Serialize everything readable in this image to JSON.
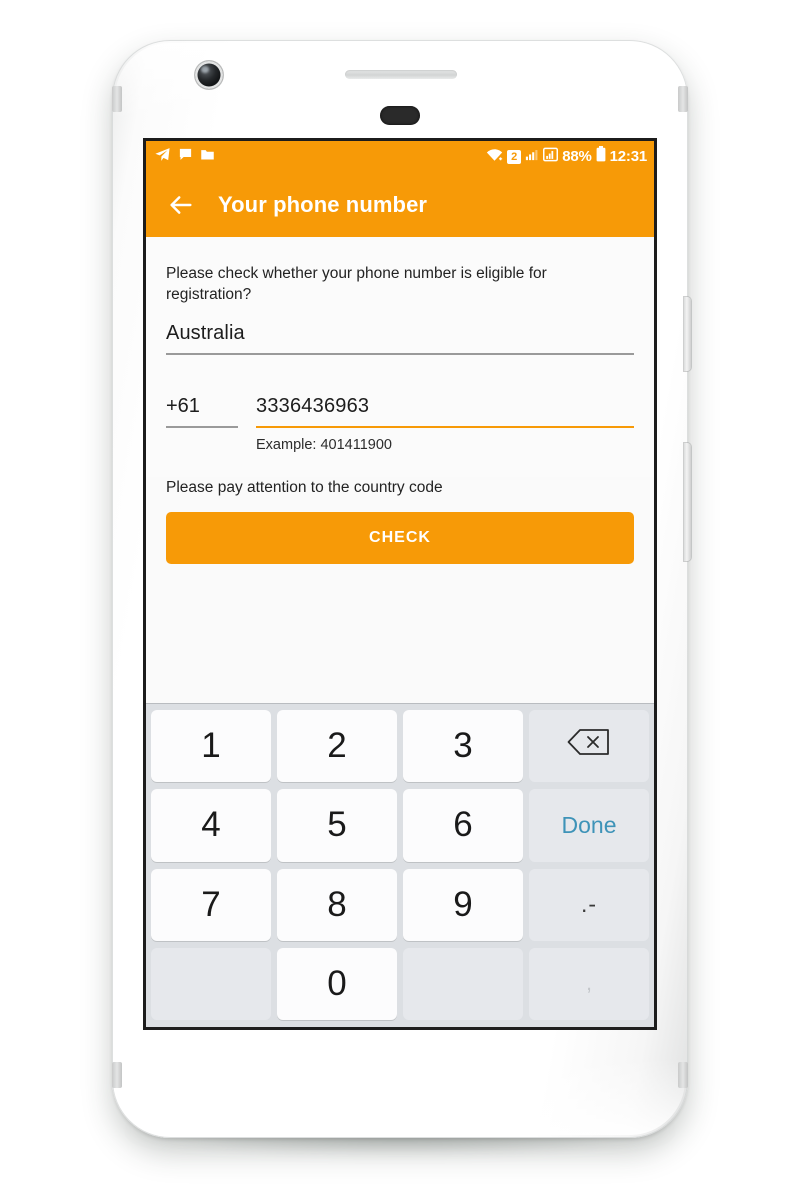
{
  "status_bar": {
    "notification_icons": [
      "telegram-icon",
      "message-icon",
      "folder-icon"
    ],
    "wifi_icon": "wifi-icon",
    "sim_badge": "2",
    "signal_icons": [
      "signal-bars-icon",
      "signal-bars-filled-icon"
    ],
    "battery_percent": "88%",
    "battery_icon": "battery-icon",
    "time": "12:31"
  },
  "app_bar": {
    "back_icon": "back-arrow-icon",
    "title": "Your phone number"
  },
  "content": {
    "prompt": "Please check whether your phone number is eligible for registration?",
    "country": {
      "value": "Australia"
    },
    "country_code": {
      "value": "+61"
    },
    "phone_number": {
      "value": "3336436963",
      "hint": "Example: 401411900"
    },
    "note": "Please pay attention to the country code",
    "check_button": "CHECK"
  },
  "keyboard": {
    "rows": [
      [
        {
          "label": "1",
          "type": "digit",
          "name": "key-1"
        },
        {
          "label": "2",
          "type": "digit",
          "name": "key-2"
        },
        {
          "label": "3",
          "type": "digit",
          "name": "key-3"
        },
        {
          "label": "",
          "type": "backspace",
          "name": "key-backspace"
        }
      ],
      [
        {
          "label": "4",
          "type": "digit",
          "name": "key-4"
        },
        {
          "label": "5",
          "type": "digit",
          "name": "key-5"
        },
        {
          "label": "6",
          "type": "digit",
          "name": "key-6"
        },
        {
          "label": "Done",
          "type": "done",
          "name": "key-done"
        }
      ],
      [
        {
          "label": "7",
          "type": "digit",
          "name": "key-7"
        },
        {
          "label": "8",
          "type": "digit",
          "name": "key-8"
        },
        {
          "label": "9",
          "type": "digit",
          "name": "key-9"
        },
        {
          "label": ".-",
          "type": "punct",
          "name": "key-dot-dash"
        }
      ],
      [
        {
          "label": "",
          "type": "blank",
          "name": "key-blank-left"
        },
        {
          "label": "0",
          "type": "digit",
          "name": "key-0"
        },
        {
          "label": "",
          "type": "blank",
          "name": "key-blank-right"
        },
        {
          "label": ",",
          "type": "comma",
          "name": "key-comma"
        }
      ]
    ]
  },
  "colors": {
    "accent": "#F79A07",
    "done_blue": "#3E93B8",
    "keyboard_bg": "#DCDFE3",
    "screen_bg": "#FBFBFB"
  }
}
